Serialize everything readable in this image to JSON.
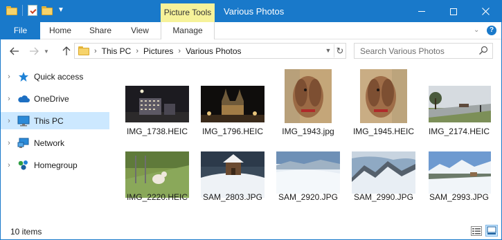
{
  "titlebar": {
    "contextual_tab": "Picture Tools",
    "window_title": "Various Photos"
  },
  "ribbon": {
    "file": "File",
    "tabs": [
      "Home",
      "Share",
      "View"
    ],
    "manage": "Manage"
  },
  "address": {
    "breadcrumbs": [
      "This PC",
      "Pictures",
      "Various Photos"
    ]
  },
  "search": {
    "placeholder": "Search Various Photos"
  },
  "sidebar": {
    "items": [
      {
        "label": "Quick access",
        "icon": "star-icon"
      },
      {
        "label": "OneDrive",
        "icon": "cloud-icon"
      },
      {
        "label": "This PC",
        "icon": "monitor-icon",
        "selected": true
      },
      {
        "label": "Network",
        "icon": "network-icon"
      },
      {
        "label": "Homegroup",
        "icon": "homegroup-icon"
      }
    ]
  },
  "files": [
    {
      "name": "IMG_1738.HEIC",
      "orientation": "landscape",
      "scene": "night-buildings"
    },
    {
      "name": "IMG_1796.HEIC",
      "orientation": "landscape",
      "scene": "night-church"
    },
    {
      "name": "IMG_1943.jpg",
      "orientation": "portrait",
      "scene": "dog"
    },
    {
      "name": "IMG_1945.HEIC",
      "orientation": "portrait",
      "scene": "dog"
    },
    {
      "name": "IMG_2174.HEIC",
      "orientation": "landscape",
      "scene": "field"
    },
    {
      "name": "IMG_2220.HEIC",
      "orientation": "landscape",
      "scene": "garden-dog"
    },
    {
      "name": "SAM_2803.JPG",
      "orientation": "landscape",
      "scene": "snow-house"
    },
    {
      "name": "SAM_2920.JPG",
      "orientation": "landscape",
      "scene": "snow-field"
    },
    {
      "name": "SAM_2990.JPG",
      "orientation": "landscape",
      "scene": "snow-mountain"
    },
    {
      "name": "SAM_2993.JPG",
      "orientation": "landscape",
      "scene": "snow-valley"
    }
  ],
  "status": {
    "item_count": "10 items"
  },
  "colors": {
    "accent": "#1979ca",
    "selected": "#cce8ff",
    "contextual": "#f6f29a"
  }
}
